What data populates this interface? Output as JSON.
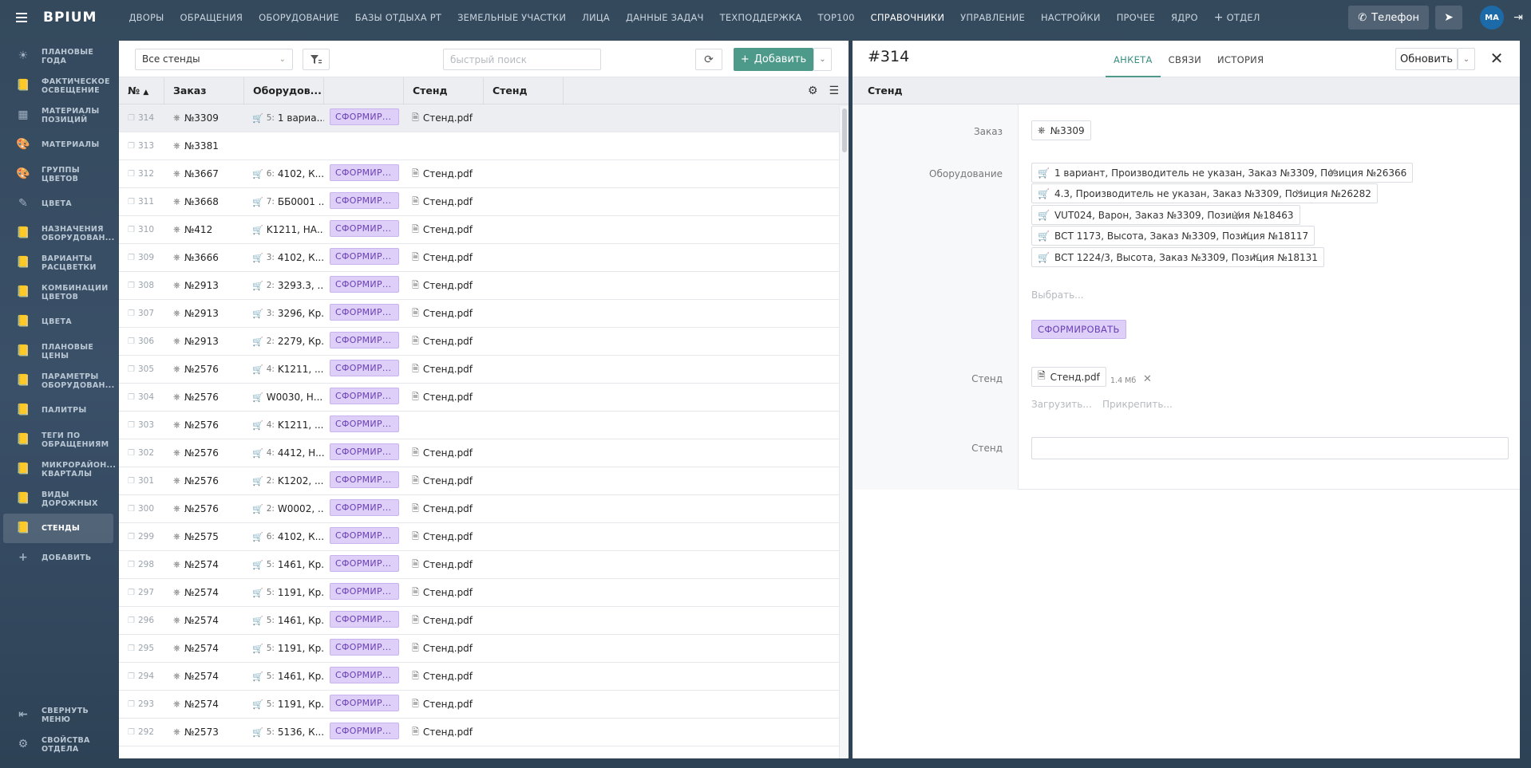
{
  "app": {
    "logo": "ВРІUМ",
    "phone_label": "Телефон",
    "avatar": "МА"
  },
  "topnav": [
    "ДВОРЫ",
    "ОБРАЩЕНИЯ",
    "ОБОРУДОВАНИЕ",
    "БАЗЫ ОТДЫХА РТ",
    "ЗЕМЕЛЬНЫЕ УЧАСТКИ",
    "ЛИЦА",
    "ДАННЫЕ ЗАДАЧ",
    "ТЕХПОДДЕРЖКА",
    "TOP100",
    "СПРАВОЧНИКИ",
    "УПРАВЛЕНИЕ",
    "НАСТРОЙКИ",
    "ПРОЧЕЕ",
    "ЯДРО"
  ],
  "topnav_extra": "ОТДЕЛ",
  "sidebar": {
    "items": [
      {
        "l1": "ПЛАНОВЫЕ",
        "l2": "ГОДА"
      },
      {
        "l1": "ФАКТИЧЕСКОЕ",
        "l2": "ОСВЕЩЕНИЕ"
      },
      {
        "l1": "МАТЕРИАЛЫ",
        "l2": "ПОЗИЦИЙ"
      },
      {
        "l1": "МАТЕРИАЛЫ",
        "l2": ""
      },
      {
        "l1": "ГРУППЫ",
        "l2": "ЦВЕТОВ"
      },
      {
        "l1": "ЦВЕТА",
        "l2": ""
      },
      {
        "l1": "НАЗНАЧЕНИЯ",
        "l2": "ОБОРУДОВАН..."
      },
      {
        "l1": "ВАРИАНТЫ",
        "l2": "РАСЦВЕТКИ"
      },
      {
        "l1": "КОМБИНАЦИИ",
        "l2": "ЦВЕТОВ"
      },
      {
        "l1": "ЦВЕТА",
        "l2": ""
      },
      {
        "l1": "ПЛАНОВЫЕ",
        "l2": "ЦЕНЫ"
      },
      {
        "l1": "ПАРАМЕТРЫ",
        "l2": "ОБОРУДОВАН..."
      },
      {
        "l1": "ПАЛИТРЫ",
        "l2": ""
      },
      {
        "l1": "ТЕГИ ПО",
        "l2": "ОБРАЩЕНИЯМ"
      },
      {
        "l1": "МИКРОРАЙОН...",
        "l2": "КВАРТАЛЫ"
      },
      {
        "l1": "ВИДЫ",
        "l2": "ДОРОЖНЫХ"
      },
      {
        "l1": "СТЕНДЫ",
        "l2": ""
      },
      {
        "l1": "ДОБАВИТЬ",
        "l2": ""
      }
    ],
    "collapse": {
      "l1": "СВЕРНУТЬ",
      "l2": "МЕНЮ"
    },
    "dept": {
      "l1": "СВОЙСТВА",
      "l2": "ОТДЕЛА"
    }
  },
  "list": {
    "filter_value": "Все стенды",
    "search_placeholder": "быстрый поиск",
    "add_label": "Добавить",
    "columns": [
      "№",
      "Заказ",
      "Оборудов...",
      "",
      "Стенд",
      "Стенд"
    ],
    "status_label": "СФОРМИР...",
    "rows": [
      {
        "num": "314",
        "order": "№3309",
        "cnt": "5:",
        "eq": "1 вариа...",
        "status": true,
        "file": "Стенд.pdf"
      },
      {
        "num": "313",
        "order": "№3381",
        "cnt": "",
        "eq": "",
        "status": false,
        "file": ""
      },
      {
        "num": "312",
        "order": "№3667",
        "cnt": "6:",
        "eq": "4102, К...",
        "status": true,
        "file": "Стенд.pdf"
      },
      {
        "num": "311",
        "order": "№3668",
        "cnt": "7:",
        "eq": "ББ0001 ...",
        "status": true,
        "file": "Стенд.pdf"
      },
      {
        "num": "310",
        "order": "№412",
        "cnt": "",
        "eq": "K1211, НА...",
        "status": true,
        "file": "Стенд.pdf"
      },
      {
        "num": "309",
        "order": "№3666",
        "cnt": "3:",
        "eq": "4102, К...",
        "status": true,
        "file": "Стенд.pdf"
      },
      {
        "num": "308",
        "order": "№2913",
        "cnt": "2:",
        "eq": "3293.3, ...",
        "status": true,
        "file": "Стенд.pdf"
      },
      {
        "num": "307",
        "order": "№2913",
        "cnt": "3:",
        "eq": "3296, Кр...",
        "status": true,
        "file": "Стенд.pdf"
      },
      {
        "num": "306",
        "order": "№2913",
        "cnt": "2:",
        "eq": "2279, Кр...",
        "status": true,
        "file": "Стенд.pdf"
      },
      {
        "num": "305",
        "order": "№2576",
        "cnt": "4:",
        "eq": "K1211, ...",
        "status": true,
        "file": "Стенд.pdf"
      },
      {
        "num": "304",
        "order": "№2576",
        "cnt": "",
        "eq": "W0030, Н...",
        "status": true,
        "file": "Стенд.pdf"
      },
      {
        "num": "303",
        "order": "№2576",
        "cnt": "4:",
        "eq": "K1211, ...",
        "status": true,
        "file": ""
      },
      {
        "num": "302",
        "order": "№2576",
        "cnt": "4:",
        "eq": "4412, Н...",
        "status": true,
        "file": "Стенд.pdf"
      },
      {
        "num": "301",
        "order": "№2576",
        "cnt": "2:",
        "eq": "K1202, ...",
        "status": true,
        "file": "Стенд.pdf"
      },
      {
        "num": "300",
        "order": "№2576",
        "cnt": "2:",
        "eq": "W0002, ...",
        "status": true,
        "file": "Стенд.pdf"
      },
      {
        "num": "299",
        "order": "№2575",
        "cnt": "6:",
        "eq": "4102, К...",
        "status": true,
        "file": "Стенд.pdf"
      },
      {
        "num": "298",
        "order": "№2574",
        "cnt": "5:",
        "eq": "1461, Кр...",
        "status": true,
        "file": "Стенд.pdf"
      },
      {
        "num": "297",
        "order": "№2574",
        "cnt": "5:",
        "eq": "1191, Кр...",
        "status": true,
        "file": "Стенд.pdf"
      },
      {
        "num": "296",
        "order": "№2574",
        "cnt": "5:",
        "eq": "1461, Кр...",
        "status": true,
        "file": "Стенд.pdf"
      },
      {
        "num": "295",
        "order": "№2574",
        "cnt": "5:",
        "eq": "1191, Кр...",
        "status": true,
        "file": "Стенд.pdf"
      },
      {
        "num": "294",
        "order": "№2574",
        "cnt": "5:",
        "eq": "1461, Кр...",
        "status": true,
        "file": "Стенд.pdf"
      },
      {
        "num": "293",
        "order": "№2574",
        "cnt": "5:",
        "eq": "1191, Кр...",
        "status": true,
        "file": "Стенд.pdf"
      },
      {
        "num": "292",
        "order": "№2573",
        "cnt": "5:",
        "eq": "5136, К...",
        "status": true,
        "file": "Стенд.pdf"
      }
    ]
  },
  "detail": {
    "title": "#314",
    "tabs": [
      "АНКЕТА",
      "СВЯЗИ",
      "ИСТОРИЯ"
    ],
    "update_label": "Обновить",
    "section": "Стенд",
    "labels": {
      "order": "Заказ",
      "equipment": "Оборудование",
      "stand1": "Стенд",
      "stand2": "Стенд"
    },
    "order_value": "№3309",
    "equipment": [
      "1 вариант, Производитель не указан, Заказ №3309, Позиция №26366",
      "4.3, Производитель не указан, Заказ №3309, Позиция №26282",
      "VUT024, Варон, Заказ №3309, Позиция №18463",
      "ВСТ 1173, Высота, Заказ №3309, Позиция №18117",
      "ВСТ 1224/3, Высота, Заказ №3309, Позиция №18131"
    ],
    "choose_label": "Выбрать...",
    "generate_label": "СФОРМИРОВАТЬ",
    "file_name": "Стенд.pdf",
    "file_size": "1.4 Мб",
    "upload_label": "Загрузить...",
    "attach_label": "Прикрепить..."
  },
  "colors": {
    "accent": "#4d9a8b",
    "badge_bg": "#ddcff7",
    "badge_fg": "#6b3fb5",
    "bg": "#34495c"
  }
}
